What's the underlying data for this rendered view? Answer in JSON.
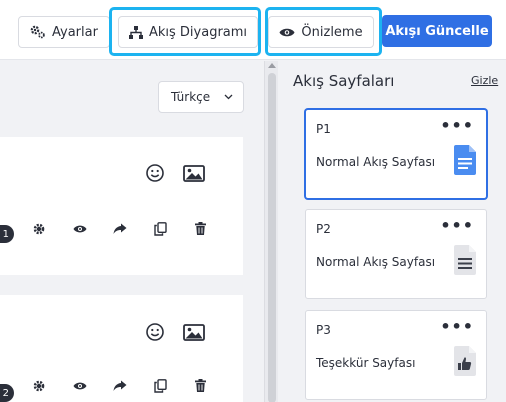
{
  "toolbar": {
    "settings_label": "Ayarlar",
    "flow_diagram_label": "Akış Diyagramı",
    "preview_label": "Önizleme",
    "update_flow_label": "Akışı Güncelle"
  },
  "canvas": {
    "language_select": {
      "value": "Türkçe"
    },
    "questions": [
      {
        "number": "1"
      },
      {
        "number": "2"
      }
    ]
  },
  "panel": {
    "title": "Akış Sayfaları",
    "hide_label": "Gizle",
    "pages": [
      {
        "id": "P1",
        "name": "Normal Akış Sayfası",
        "icon": "document-blue-icon",
        "active": true
      },
      {
        "id": "P2",
        "name": "Normal Akış Sayfası",
        "icon": "document-gray-icon",
        "active": false
      },
      {
        "id": "P3",
        "name": "Teşekkür Sayfası",
        "icon": "thumbs-up-document-icon",
        "active": false
      }
    ]
  },
  "colors": {
    "primary": "#2f6fe4",
    "highlight": "#1cb3f0",
    "background": "#f1f2f5",
    "doc_blue": "#4a8cf0",
    "doc_gray": "#e3e4e8"
  }
}
